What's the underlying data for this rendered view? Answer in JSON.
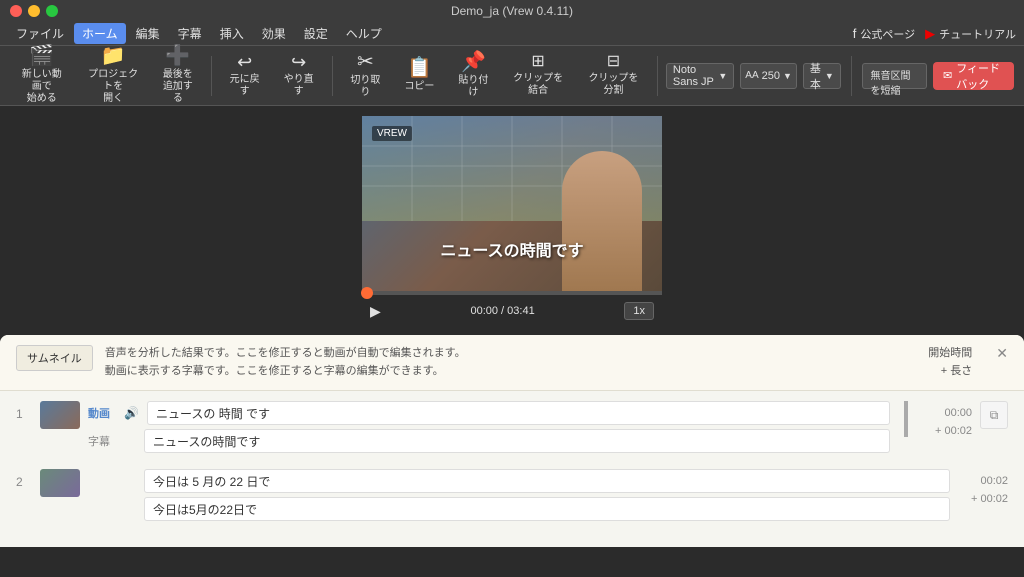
{
  "app": {
    "title": "Demo_ja (Vrew 0.4.11)"
  },
  "titlebar": {
    "traffic_lights": [
      "red",
      "yellow",
      "green"
    ]
  },
  "menubar": {
    "items": [
      {
        "label": "ファイル",
        "active": false
      },
      {
        "label": "ホーム",
        "active": true
      },
      {
        "label": "編集",
        "active": false
      },
      {
        "label": "字幕",
        "active": false
      },
      {
        "label": "挿入",
        "active": false
      },
      {
        "label": "効果",
        "active": false
      },
      {
        "label": "設定",
        "active": false
      },
      {
        "label": "ヘルプ",
        "active": false
      }
    ],
    "right_links": [
      {
        "label": "公式ページ"
      },
      {
        "label": "チュートリアル"
      }
    ]
  },
  "toolbar": {
    "buttons": [
      {
        "id": "new-video",
        "icon": "🎬",
        "label": "新しい動画で\n始める"
      },
      {
        "id": "open-project",
        "icon": "📁",
        "label": "プロジェクトを\n開く"
      },
      {
        "id": "add-segment",
        "icon": "➕",
        "label": "最後を\n追加する"
      }
    ],
    "separator_after": [
      2
    ],
    "history_buttons": [
      {
        "id": "undo",
        "icon": "↩",
        "label": "元に戻す"
      },
      {
        "id": "redo",
        "icon": "↪",
        "label": "やり直す"
      }
    ],
    "edit_buttons": [
      {
        "id": "cut",
        "icon": "✂",
        "label": "切り取り"
      },
      {
        "id": "copy",
        "icon": "📋",
        "label": "コピー"
      },
      {
        "id": "paste",
        "icon": "📌",
        "label": "貼り付け"
      },
      {
        "id": "merge",
        "icon": "⊞",
        "label": "クリップを結合"
      },
      {
        "id": "split",
        "icon": "⊟",
        "label": "クリップを分割"
      }
    ],
    "font_selector": {
      "value": "Noto Sans JP",
      "label": "Noto Sans JP"
    },
    "font_size": {
      "prefix": "AA",
      "value": "250"
    },
    "style_selector": {
      "value": "基本",
      "label": "基本"
    },
    "silence_btn": "無音区間を短縮",
    "feedback_btn": "フィードバック"
  },
  "video": {
    "subtitle": "ニュースの時間です",
    "time_current": "00:00",
    "time_total": "03:41",
    "speed": "1x",
    "progress_percent": 2
  },
  "editor": {
    "header": {
      "thumbnail_btn": "サムネイル",
      "hint_line1": "音声を分析した結果です。ここを修正すると動画が自動で編集されます。",
      "hint_line2": "動画に表示する字幕です。ここを修正すると字幕の編集ができます。",
      "right_label1": "開始時間",
      "right_label2": "+ 長さ"
    },
    "clips": [
      {
        "number": "1",
        "has_thumbnail": true,
        "type_video": "動画",
        "type_subtitle": "字幕",
        "transcript": "ニュースの 時間 です",
        "subtitle": "ニュースの時間です",
        "time": "00:00",
        "duration": "+ 00:02",
        "has_indicator": true
      },
      {
        "number": "2",
        "has_thumbnail": true,
        "type_video": "",
        "type_subtitle": "",
        "transcript": "今日は 5 月の 22 日で",
        "subtitle": "今日は5月の22日で",
        "time": "00:02",
        "duration": "+ 00:02",
        "has_indicator": false
      }
    ]
  }
}
